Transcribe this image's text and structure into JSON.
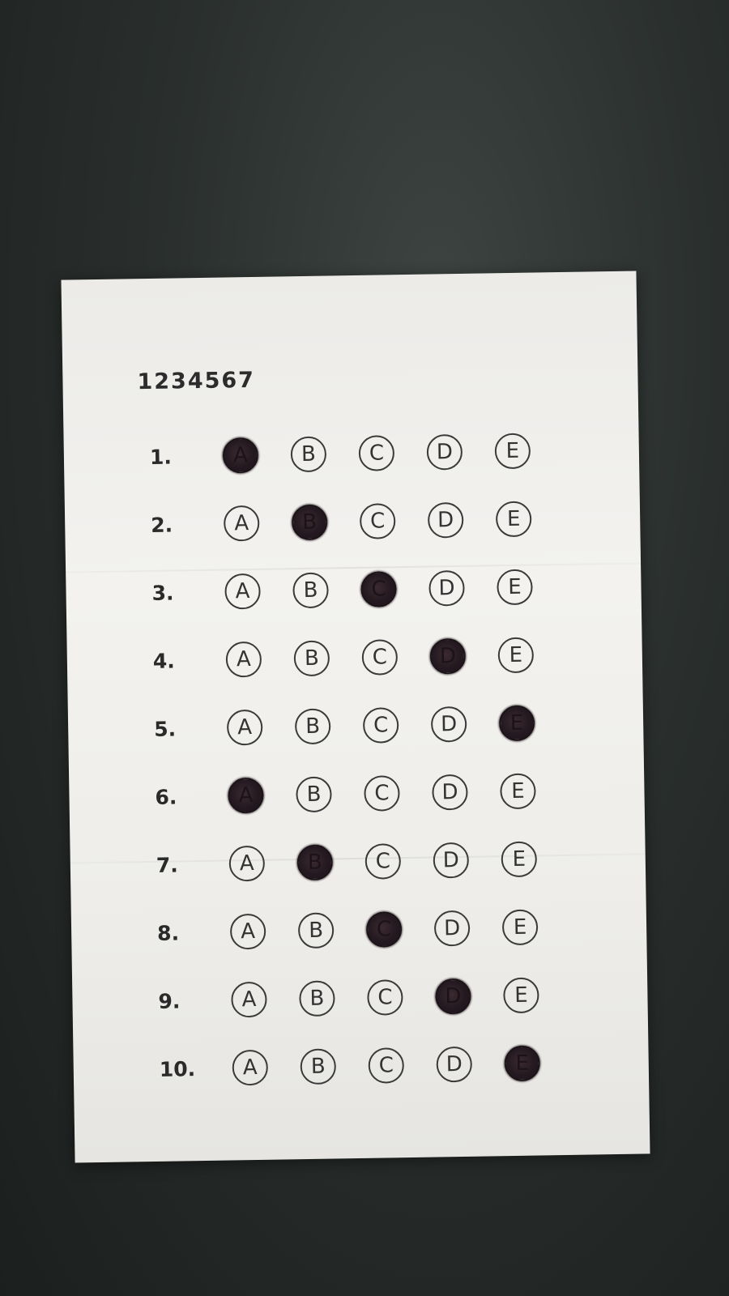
{
  "sheet": {
    "code": "1234567",
    "questions": [
      {
        "number": "1.",
        "options": [
          "A",
          "B",
          "C",
          "D",
          "E"
        ],
        "marked": "A"
      },
      {
        "number": "2.",
        "options": [
          "A",
          "B",
          "C",
          "D",
          "E"
        ],
        "marked": "B"
      },
      {
        "number": "3.",
        "options": [
          "A",
          "B",
          "C",
          "D",
          "E"
        ],
        "marked": "C"
      },
      {
        "number": "4.",
        "options": [
          "A",
          "B",
          "C",
          "D",
          "E"
        ],
        "marked": "D"
      },
      {
        "number": "5.",
        "options": [
          "A",
          "B",
          "C",
          "D",
          "E"
        ],
        "marked": "E"
      },
      {
        "number": "6.",
        "options": [
          "A",
          "B",
          "C",
          "D",
          "E"
        ],
        "marked": "A"
      },
      {
        "number": "7.",
        "options": [
          "A",
          "B",
          "C",
          "D",
          "E"
        ],
        "marked": "B"
      },
      {
        "number": "8.",
        "options": [
          "A",
          "B",
          "C",
          "D",
          "E"
        ],
        "marked": "C"
      },
      {
        "number": "9.",
        "options": [
          "A",
          "B",
          "C",
          "D",
          "E"
        ],
        "marked": "D"
      },
      {
        "number": "10.",
        "options": [
          "A",
          "B",
          "C",
          "D",
          "E"
        ],
        "marked": "E"
      }
    ]
  },
  "colors": {
    "paper": "#f0efec",
    "background": "#242927",
    "ink": "#241920"
  }
}
